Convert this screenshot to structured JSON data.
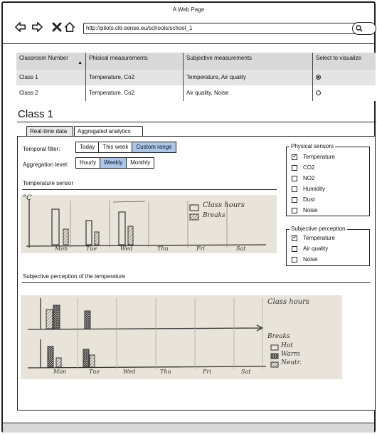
{
  "window": {
    "title": "A Web Page"
  },
  "browser": {
    "url": "http://pilots.citi-sense.eu/schools/school_1"
  },
  "table": {
    "headers": [
      "Classroom Number",
      "Phisical measurements",
      "Subjective measurements",
      "Select to visualize"
    ],
    "rows": [
      {
        "classroom": "Class 1",
        "physical": "Temperature, Co2",
        "subjective": "Temperature, Air quality",
        "selected": true
      },
      {
        "classroom": "Class 2",
        "physical": "Temperature, Co2",
        "subjective": "Air quality, Noise",
        "selected": false
      }
    ]
  },
  "page": {
    "title": "Class 1"
  },
  "tabs": [
    {
      "label": "Real-time data",
      "active": false
    },
    {
      "label": "Aggregated analytics",
      "active": true
    }
  ],
  "filters": {
    "temporal_label": "Temporal filter:",
    "temporal_options": [
      "Today",
      "This week",
      "Custom range"
    ],
    "temporal_selected": "Custom range",
    "aggregation_label": "Aggregation level:",
    "aggregation_options": [
      "Hourly",
      "Weekly",
      "Monthly"
    ],
    "aggregation_selected": "Weekly"
  },
  "sections": {
    "temperature_title": "Temperature sensor",
    "perception_title": "Subjective perception of the temperature"
  },
  "sketch1": {
    "y_unit": "°C",
    "days": [
      "Mon",
      "Tue",
      "Wed",
      "Thu",
      "Fri",
      "Sat"
    ],
    "legend": [
      "Class hours",
      "Breaks"
    ]
  },
  "sketch2": {
    "days": [
      "Mon",
      "Tue",
      "Wed",
      "Thu",
      "Fri",
      "Sat"
    ],
    "top_label": "Class hours",
    "bottom_label": "Breaks",
    "legend": [
      "Hot",
      "Warm",
      "Neutr."
    ]
  },
  "physical_sensors": {
    "legend": "Physical sensors",
    "items": [
      {
        "label": "Temperature",
        "checked": true
      },
      {
        "label": "CO2",
        "checked": false
      },
      {
        "label": "NO2",
        "checked": false
      },
      {
        "label": "Humidity",
        "checked": false
      },
      {
        "label": "Dust",
        "checked": false
      },
      {
        "label": "Noise",
        "checked": false
      }
    ]
  },
  "subjective_perception": {
    "legend": "Subjective perception",
    "items": [
      {
        "label": "Temperature",
        "checked": true
      },
      {
        "label": "Air quality",
        "checked": false
      },
      {
        "label": "Noise",
        "checked": false
      }
    ]
  },
  "colors": {
    "selected_segment": "#a9c7ea",
    "photo_paper": "#e9e4da",
    "table_header": "#d9d9d9"
  }
}
